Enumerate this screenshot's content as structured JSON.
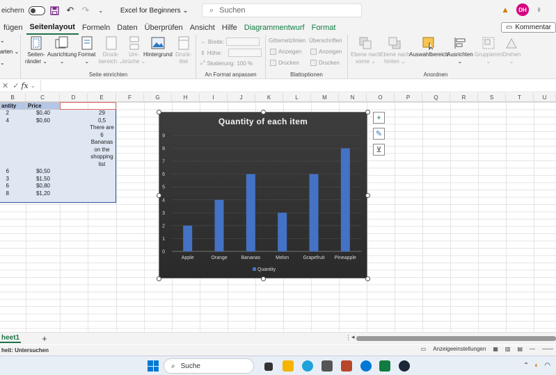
{
  "titlebar": {
    "autosave_label": "eichern",
    "doc_title": "Excel for Beginners ⌄",
    "search_placeholder": "Suchen",
    "avatar_initials": "DH"
  },
  "tabs": [
    {
      "label": "fügen"
    },
    {
      "label": "Seitenlayout"
    },
    {
      "label": "Formeln"
    },
    {
      "label": "Daten"
    },
    {
      "label": "Überprüfen"
    },
    {
      "label": "Ansicht"
    },
    {
      "label": "Hilfe"
    },
    {
      "label": "Diagrammentwurf"
    },
    {
      "label": "Format"
    }
  ],
  "comments_label": "Kommentar",
  "ribbon": {
    "left_stub": [
      "⌄",
      "arten ⌄",
      "⌄"
    ],
    "seite": {
      "label": "Seite einrichten",
      "buttons": [
        "Seiten-\nränder ⌄",
        "Ausrichtung\n⌄",
        "Format\n⌄",
        "Druck-\nbereich ⌄",
        "Um-\nbrüche ⌄",
        "Hintergrund",
        "Druck-\ntitel"
      ]
    },
    "anpassen": {
      "label": "An Format anpassen",
      "breite": "Breite:",
      "hoehe": "Höhe:",
      "skalierung": "Skalierung:",
      "skalierung_value": "100 %"
    },
    "blatt": {
      "label": "Blattoptionen",
      "col1_title": "Gitternetzlinien",
      "col2_title": "Überschriften",
      "anzeigen": "Anzeigen",
      "drucken": "Drucken"
    },
    "anordnen": {
      "label": "Anordnen",
      "buttons": [
        "Ebene nach\nvorne ⌄",
        "Ebene nach\nhinten ⌄",
        "Auswahlbereich",
        "Ausrichten\n⌄",
        "Gruppieren\n⌄",
        "Drehen\n⌄"
      ]
    }
  },
  "formula_bar": {
    "cancel": "✕",
    "confirm": "✓",
    "fx": "fx"
  },
  "columns": [
    "B",
    "C",
    "D",
    "E",
    "F",
    "G",
    "H",
    "I",
    "J",
    "K",
    "L",
    "M",
    "N",
    "O",
    "P",
    "Q",
    "R",
    "S",
    "T",
    "U"
  ],
  "table": {
    "headers": [
      "antity",
      "Price"
    ],
    "rows": [
      [
        "2",
        "$0,40",
        "29"
      ],
      [
        "4",
        "$0,60",
        "0,5"
      ],
      [
        "",
        "",
        "There are"
      ],
      [
        "",
        "",
        "6"
      ],
      [
        "",
        "",
        "Bananas"
      ],
      [
        "",
        "",
        "on the"
      ],
      [
        "",
        "",
        "shopping"
      ],
      [
        "",
        "",
        "list"
      ],
      [
        "6",
        "$0,50",
        ""
      ],
      [
        "3",
        "$1,50",
        ""
      ],
      [
        "6",
        "$0,80",
        ""
      ],
      [
        "8",
        "$1,20",
        ""
      ]
    ]
  },
  "chart_data": {
    "type": "bar",
    "title": "Quantity of each item",
    "categories": [
      "Apple",
      "Orange",
      "Bananas",
      "Melon",
      "Grapefruit",
      "Pineapple"
    ],
    "series": [
      {
        "name": "Quantity",
        "values": [
          2,
          4,
          6,
          3,
          6,
          8
        ]
      }
    ],
    "ylim": [
      0,
      9
    ],
    "yticks": [
      0,
      1,
      2,
      3,
      4,
      5,
      6,
      7,
      8,
      9
    ],
    "grid": true,
    "legend": "bottom",
    "colors": {
      "bar": "#4472c4",
      "background": "#333333",
      "text": "#d9d9d9"
    }
  },
  "chart_tools": [
    "+",
    "✎",
    "⊻"
  ],
  "sheet": {
    "tab_label": "heet1",
    "add": "+"
  },
  "status": {
    "left": "heit: Untersuchen",
    "display_settings": "Anzeigeeinstellungen"
  },
  "taskbar": {
    "search_label": "Suche"
  }
}
